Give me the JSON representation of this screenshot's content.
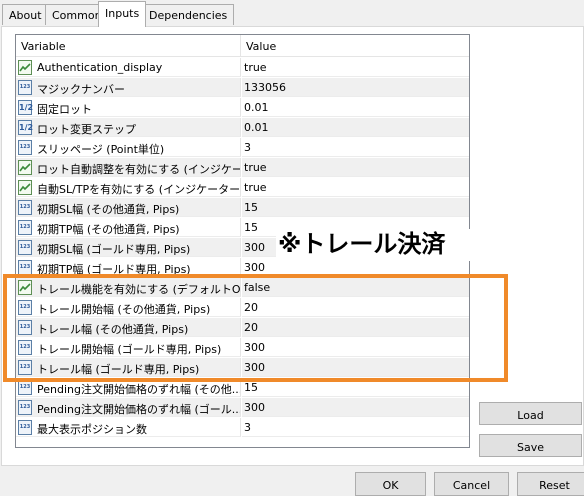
{
  "tabs": [
    {
      "label": "About"
    },
    {
      "label": "Common"
    },
    {
      "label": "Inputs",
      "active": true
    },
    {
      "label": "Dependencies"
    }
  ],
  "grid": {
    "header": {
      "variable": "Variable",
      "value": "Value"
    },
    "rows": [
      {
        "type": "bool",
        "name": "Authentication_display",
        "value": "true"
      },
      {
        "type": "int",
        "name": "マジックナンバー",
        "value": "133056"
      },
      {
        "type": "double",
        "name": "固定ロット",
        "value": "0.01"
      },
      {
        "type": "double",
        "name": "ロット変更ステップ",
        "value": "0.01"
      },
      {
        "type": "int",
        "name": "スリッページ (Point単位)",
        "value": "3"
      },
      {
        "type": "bool",
        "name": "ロット自動調整を有効にする (インジケー...",
        "value": "true"
      },
      {
        "type": "bool",
        "name": "自動SL/TPを有効にする (インジケーター...",
        "value": "true"
      },
      {
        "type": "int",
        "name": "初期SL幅 (その他通貨, Pips)",
        "value": "15"
      },
      {
        "type": "int",
        "name": "初期TP幅 (その他通貨, Pips)",
        "value": "15"
      },
      {
        "type": "int",
        "name": "初期SL幅 (ゴールド専用, Pips)",
        "value": "300"
      },
      {
        "type": "int",
        "name": "初期TP幅 (ゴールド専用, Pips)",
        "value": "300"
      },
      {
        "type": "bool",
        "name": "トレール機能を有効にする (デフォルトON)",
        "value": "false"
      },
      {
        "type": "int",
        "name": "トレール開始幅 (その他通貨, Pips)",
        "value": "20"
      },
      {
        "type": "int",
        "name": "トレール幅 (その他通貨, Pips)",
        "value": "20"
      },
      {
        "type": "int",
        "name": "トレール開始幅 (ゴールド専用, Pips)",
        "value": "300"
      },
      {
        "type": "int",
        "name": "トレール幅 (ゴールド専用, Pips)",
        "value": "300"
      },
      {
        "type": "int",
        "name": "Pending注文開始価格のずれ幅 (その他...",
        "value": "15"
      },
      {
        "type": "int",
        "name": "Pending注文開始価格のずれ幅 (ゴール...",
        "value": "300"
      },
      {
        "type": "int",
        "name": "最大表示ポジション数",
        "value": "3"
      }
    ]
  },
  "icons": {
    "int": "123",
    "double": "1/2"
  },
  "buttons": {
    "load": "Load",
    "save": "Save",
    "ok": "OK",
    "cancel": "Cancel",
    "reset": "Reset"
  },
  "annotation": {
    "text": "※トレール決済",
    "highlight_color": "#f08a2a"
  }
}
